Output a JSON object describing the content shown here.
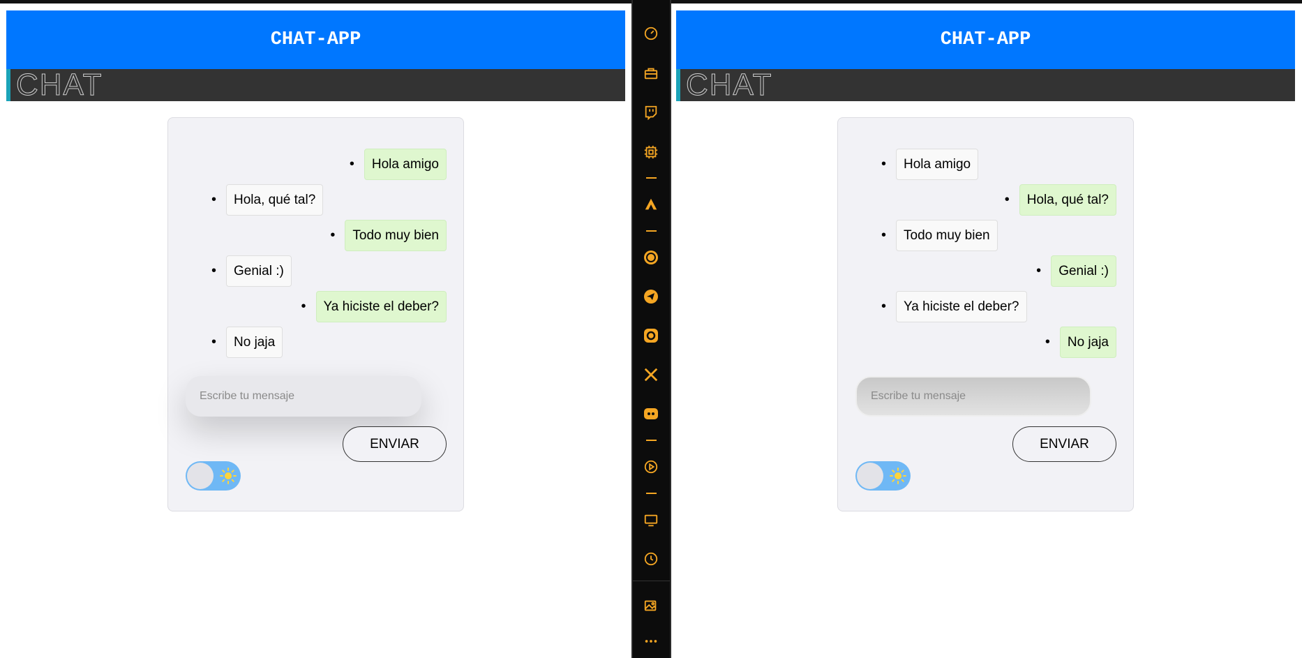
{
  "left_pane": {
    "app_title": "CHAT-APP",
    "banner_text": "CHAT",
    "messages": [
      {
        "text": "Hola amigo",
        "side": "sent"
      },
      {
        "text": "Hola, qué tal?",
        "side": "received"
      },
      {
        "text": "Todo muy bien",
        "side": "sent"
      },
      {
        "text": "Genial :)",
        "side": "received"
      },
      {
        "text": "Ya hiciste el deber?",
        "side": "sent"
      },
      {
        "text": "No jaja",
        "side": "received"
      }
    ],
    "input": {
      "placeholder": "Escribe tu mensaje",
      "value": ""
    },
    "send_label": "ENVIAR",
    "theme_toggle": {
      "state": "light"
    }
  },
  "right_pane": {
    "app_title": "CHAT-APP",
    "banner_text": "CHAT",
    "messages": [
      {
        "text": "Hola amigo",
        "side": "received"
      },
      {
        "text": "Hola, qué tal?",
        "side": "sent"
      },
      {
        "text": "Todo muy bien",
        "side": "received"
      },
      {
        "text": "Genial :)",
        "side": "sent"
      },
      {
        "text": "Ya hiciste el deber?",
        "side": "received"
      },
      {
        "text": "No jaja",
        "side": "sent"
      }
    ],
    "input": {
      "placeholder": "Escribe tu mensaje",
      "value": ""
    },
    "send_label": "ENVIAR",
    "theme_toggle": {
      "state": "light"
    }
  },
  "dock": {
    "accent_color": "#f5a623",
    "icons": [
      "speedometer-icon",
      "toolbox-icon",
      "twitch-icon",
      "chip-icon",
      "aria-icon",
      "whatsapp-icon",
      "telegram-icon",
      "instagram-icon",
      "x-icon",
      "discord-icon",
      "play-icon",
      "screen-icon",
      "clock-icon",
      "gallery-icon",
      "more-icon"
    ]
  },
  "colors": {
    "header_blue": "#0077ff",
    "banner_dark": "#333333",
    "bubble_sent": "#dff7cf",
    "bubble_received": "#f9f9f9",
    "card_bg": "#f2f2f6",
    "toggle_blue": "#6fb8f5"
  }
}
